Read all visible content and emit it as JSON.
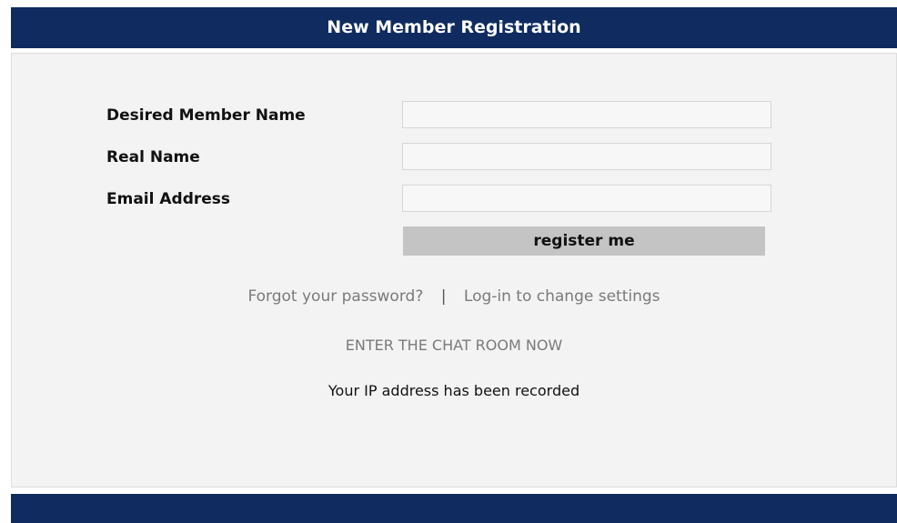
{
  "header": {
    "title": "New Member Registration"
  },
  "form": {
    "fields": [
      {
        "label": "Desired Member Name",
        "value": "",
        "placeholder": ""
      },
      {
        "label": "Real Name",
        "value": "",
        "placeholder": ""
      },
      {
        "label": "Email Address",
        "value": "",
        "placeholder": ""
      }
    ],
    "submit_label": "register me"
  },
  "links": {
    "forgot_password": "Forgot your password?",
    "separator": "|",
    "login_change": "Log-in to change settings",
    "chat_room": "ENTER THE CHAT ROOM NOW"
  },
  "notice": {
    "ip_recorded": "Your IP address has been recorded"
  },
  "colors": {
    "brand_navy": "#0f2b5f",
    "panel_bg": "#f3f3f3",
    "button_bg": "#c4c4c4",
    "link_gray": "#7a7a7a"
  }
}
